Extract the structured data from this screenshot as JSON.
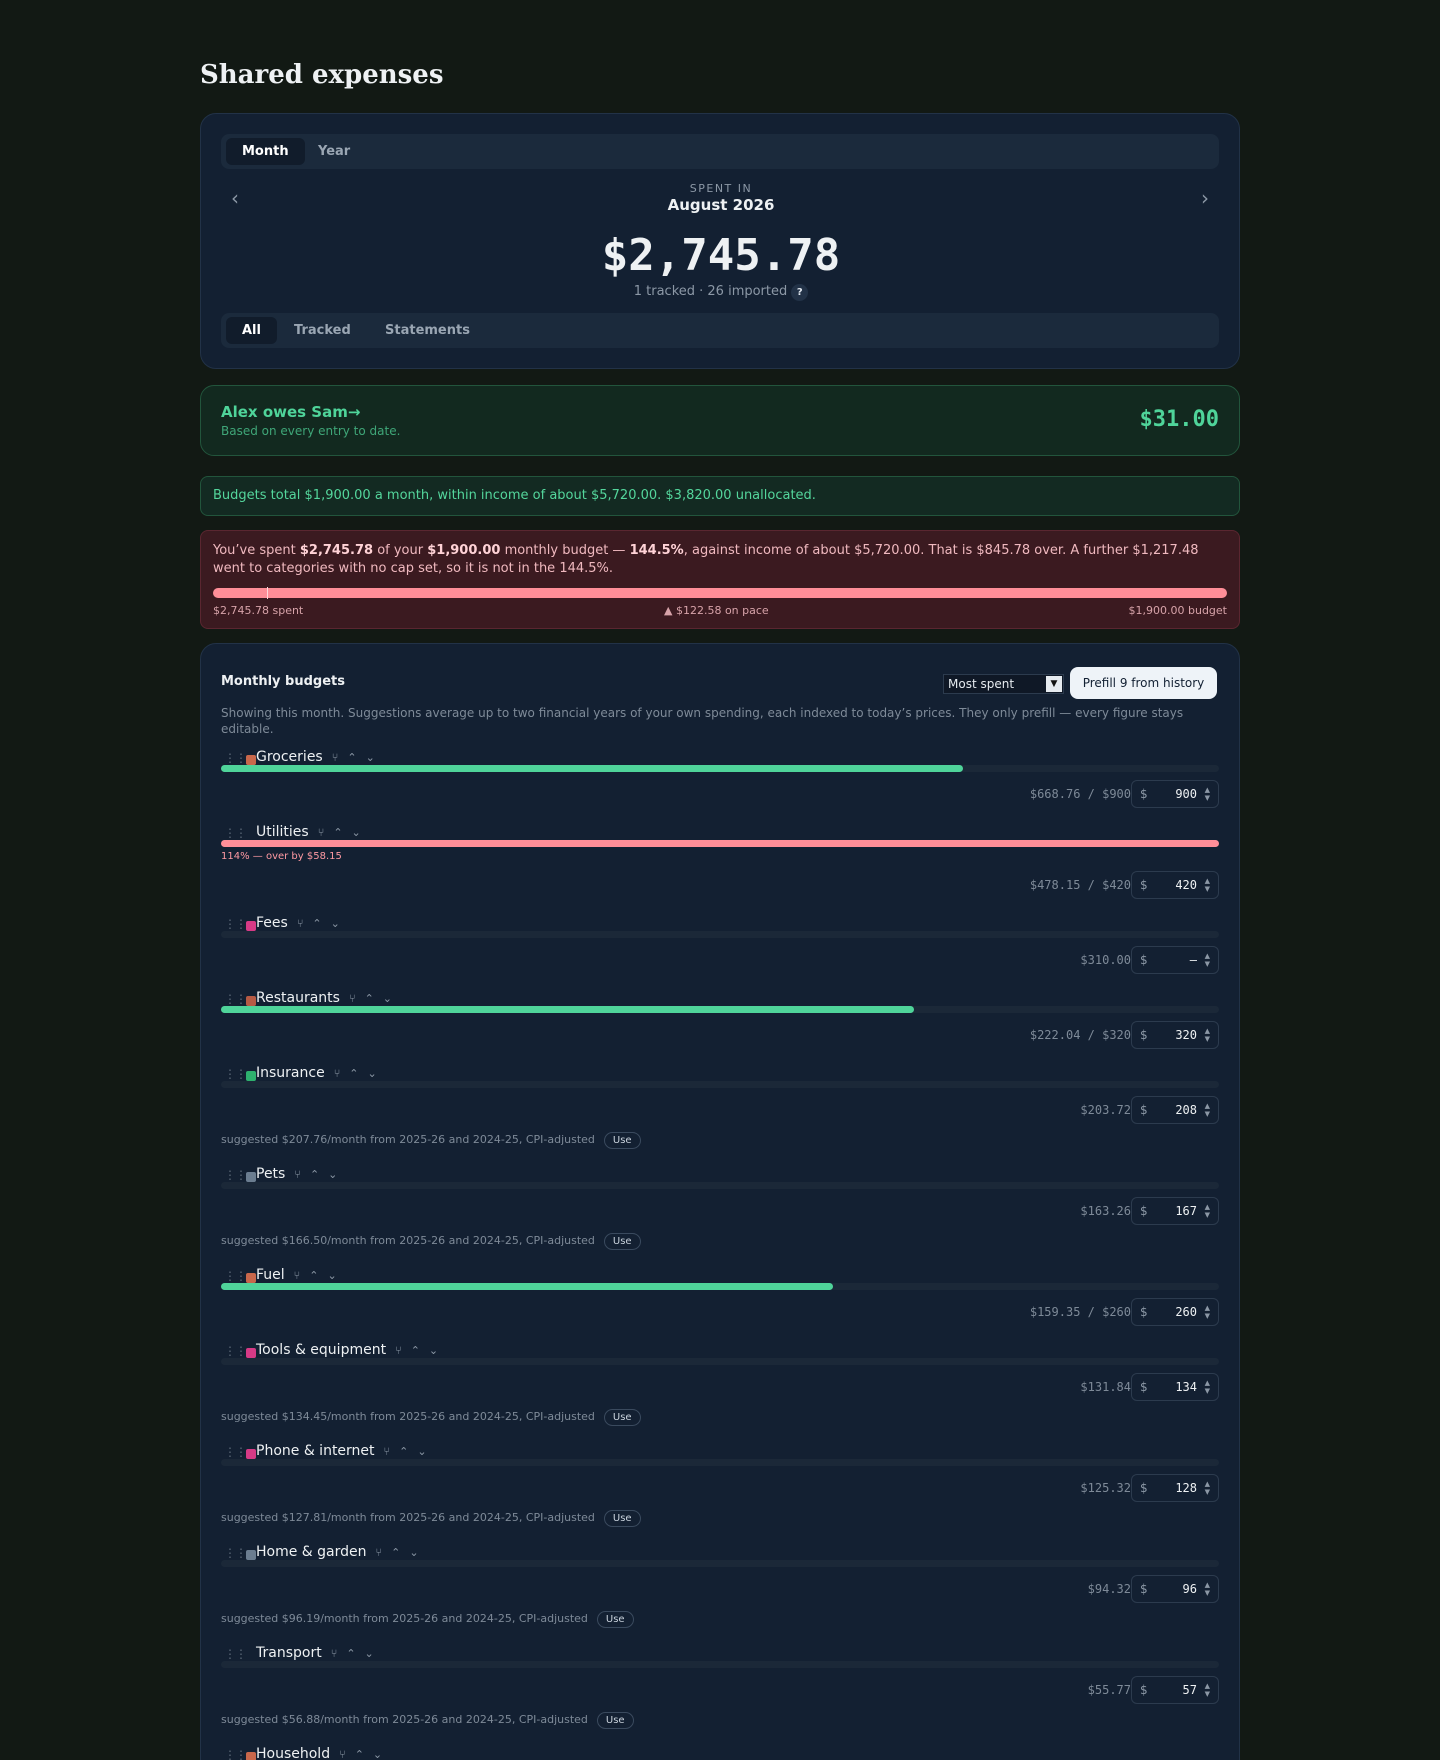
{
  "page": {
    "title": "Shared expenses"
  },
  "summary": {
    "view_tabs": [
      "Month",
      "Year"
    ],
    "spent_label": "SPENT IN",
    "period": "August 2026",
    "total": "$2,745.78",
    "counts": "1 tracked · 26 imported",
    "help": "?",
    "source_tabs": [
      "All",
      "Tracked",
      "Statements"
    ],
    "prev_icon": "chevron-left-icon",
    "next_icon": "chevron-right-icon"
  },
  "settlement": {
    "title": "Alex owes Sam",
    "arrow": "→",
    "subtitle": "Based on every entry to date.",
    "amount": "$31.00"
  },
  "budget_info": "Budgets total $1,900.00 a month, within income of about $5,720.00. $3,820.00 unallocated.",
  "overspend": {
    "p1": "You’ve spent ",
    "spent": "$2,745.78",
    "p2": " of your ",
    "budget": "$1,900.00",
    "p3": " monthly budget — ",
    "pct": "144.5%",
    "p4": ", against income of about $5,720.00. That is $845.78 over. A further $1,217.48 went to categories with no cap set, so it is not in the 144.5%.",
    "foot_left": "$2,745.78 spent",
    "foot_mid": "▲ $122.58 on pace",
    "foot_right": "$1,900.00 budget",
    "fill_fraction": 1.0
  },
  "monthly_budgets": {
    "title": "Monthly budgets",
    "sort_value": "Most spent",
    "sort_caret": "▼",
    "prefill_label": "Prefill 9 from history",
    "note": "Showing this month. Suggestions average up to two financial years of your own spending, each indexed to today’s prices. They only prefill — every figure stays editable.",
    "currency": "$",
    "use_label": "Use",
    "grip": "⋮⋮",
    "split_glyph": "⑂",
    "up_glyph": "⌃",
    "down_glyph": "⌄",
    "categories": [
      {
        "name": "Groceries",
        "color": "#c8674b",
        "amount": "$668.76 / $900",
        "budget": "900",
        "fill": 0.743
      },
      {
        "name": "Utilities",
        "color": "",
        "amount": "$478.15 / $420",
        "budget": "420",
        "fill": 1.0,
        "over": "114% — over by $58.15"
      },
      {
        "name": "Fees",
        "color": "#d63a86",
        "amount": "$310.00",
        "budget": "–"
      },
      {
        "name": "Restaurants",
        "color": "#b65a44",
        "amount": "$222.04 / $320",
        "budget": "320",
        "fill": 0.694
      },
      {
        "name": "Insurance",
        "color": "#2eb06e",
        "amount": "$203.72",
        "budget": "208",
        "suggestion": "suggested $207.76/month from 2025-26 and 2024-25, CPI-adjusted"
      },
      {
        "name": "Pets",
        "color": "#6b7d90",
        "amount": "$163.26",
        "budget": "167",
        "suggestion": "suggested $166.50/month from 2025-26 and 2024-25, CPI-adjusted"
      },
      {
        "name": "Fuel",
        "color": "#c8674b",
        "amount": "$159.35 / $260",
        "budget": "260",
        "fill": 0.613
      },
      {
        "name": "Tools & equipment",
        "color": "#d63a86",
        "amount": "$131.84",
        "budget": "134",
        "suggestion": "suggested $134.45/month from 2025-26 and 2024-25, CPI-adjusted"
      },
      {
        "name": "Phone & internet",
        "color": "#d63a86",
        "amount": "$125.32",
        "budget": "128",
        "suggestion": "suggested $127.81/month from 2025-26 and 2024-25, CPI-adjusted"
      },
      {
        "name": "Home & garden",
        "color": "#6b7d90",
        "amount": "$94.32",
        "budget": "96",
        "suggestion": "suggested $96.19/month from 2025-26 and 2024-25, CPI-adjusted"
      },
      {
        "name": "Transport",
        "color": "",
        "amount": "$55.77",
        "budget": "57",
        "suggestion": "suggested $56.88/month from 2025-26 and 2024-25, CPI-adjusted"
      },
      {
        "name": "Household",
        "color": "#c8674b"
      }
    ]
  },
  "colors": {
    "background": "#121914",
    "card": "#132032",
    "accent_green": "#4fd49a",
    "over_red": "#ff8e98",
    "alert_bg": "#3b1a20"
  }
}
